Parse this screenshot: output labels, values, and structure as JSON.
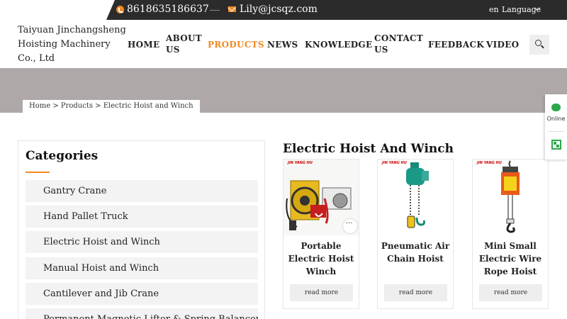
{
  "topbar": {
    "phone": "8618635186637",
    "email": "Lily@jcsqz.com",
    "lang_code": "en",
    "lang_label": "Language"
  },
  "header": {
    "brand": "Taiyuan Jinchangsheng Hoisting Machinery Co., Ltd"
  },
  "nav": {
    "home": "HOME",
    "about": "ABOUT US",
    "products": "PRODUCTS",
    "news": "NEWS",
    "knowledge": "KNOWLEDGE",
    "contact": "CONTACT US",
    "feedback": "FEEDBACK",
    "video": "VIDEO"
  },
  "breadcrumb": "Home > Products > Electric Hoist and Winch",
  "sidebar": {
    "title": "Categories",
    "items": [
      "Gantry Crane",
      "Hand Pallet Truck",
      "Electric Hoist and Winch",
      "Manual Hoist and Winch",
      "Cantilever and Jib Crane",
      "Permanent Magnetic Lifter & Spring Balancer"
    ]
  },
  "main": {
    "title": "Electric Hoist And Winch",
    "products": [
      {
        "name": "Portable Electric Hoist Winch",
        "button": "read more",
        "brand_mark": "JIN YANG HU"
      },
      {
        "name": "Pneumatic Air Chain Hoist",
        "button": "read more",
        "brand_mark": "JIN YANG HU"
      },
      {
        "name": "Mini Small Electric Wire Rope Hoist",
        "button": "read more",
        "brand_mark": "JIN YANG HU"
      }
    ]
  },
  "float_panel": {
    "online": "Online"
  },
  "colors": {
    "accent": "#f08a24",
    "topbar": "#2b2b2b",
    "banner": "#afa8a8",
    "online_green": "#2ba84a"
  }
}
